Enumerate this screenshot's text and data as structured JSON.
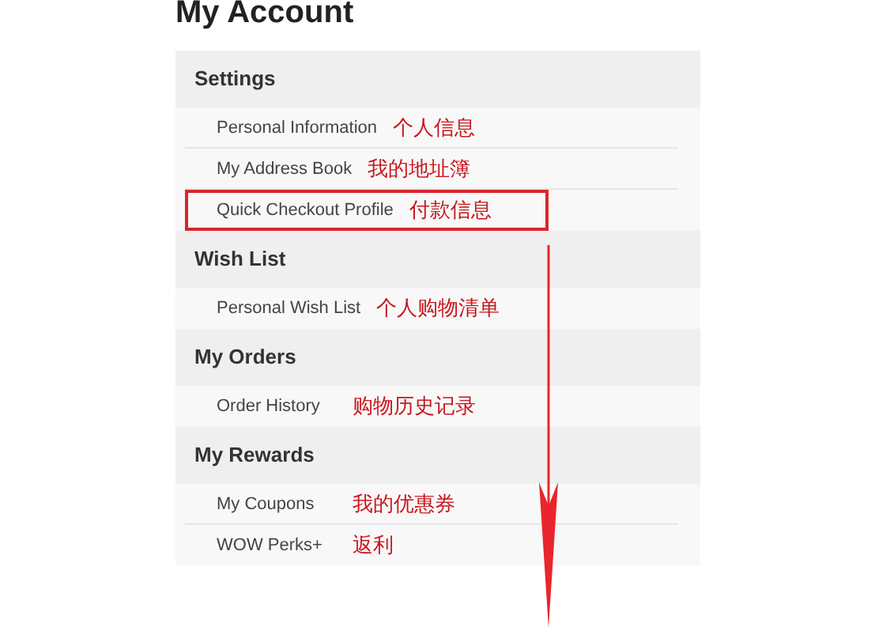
{
  "title": "My Account",
  "sections": [
    {
      "heading": "Settings",
      "items": [
        {
          "label": "Personal Information",
          "note": "个人信息",
          "highlighted": false
        },
        {
          "label": "My Address Book",
          "note": "我的地址簿",
          "highlighted": false
        },
        {
          "label": "Quick Checkout Profile",
          "note": "付款信息",
          "highlighted": true
        }
      ]
    },
    {
      "heading": "Wish List",
      "items": [
        {
          "label": "Personal Wish List",
          "note": "个人购物清单",
          "highlighted": false
        }
      ]
    },
    {
      "heading": "My Orders",
      "items": [
        {
          "label": "Order History",
          "note": "购物历史记录",
          "highlighted": false
        }
      ]
    },
    {
      "heading": "My Rewards",
      "items": [
        {
          "label": "My Coupons",
          "note": "我的优惠券",
          "highlighted": false
        },
        {
          "label": "WOW Perks+",
          "note": "返利",
          "highlighted": false
        }
      ]
    }
  ]
}
